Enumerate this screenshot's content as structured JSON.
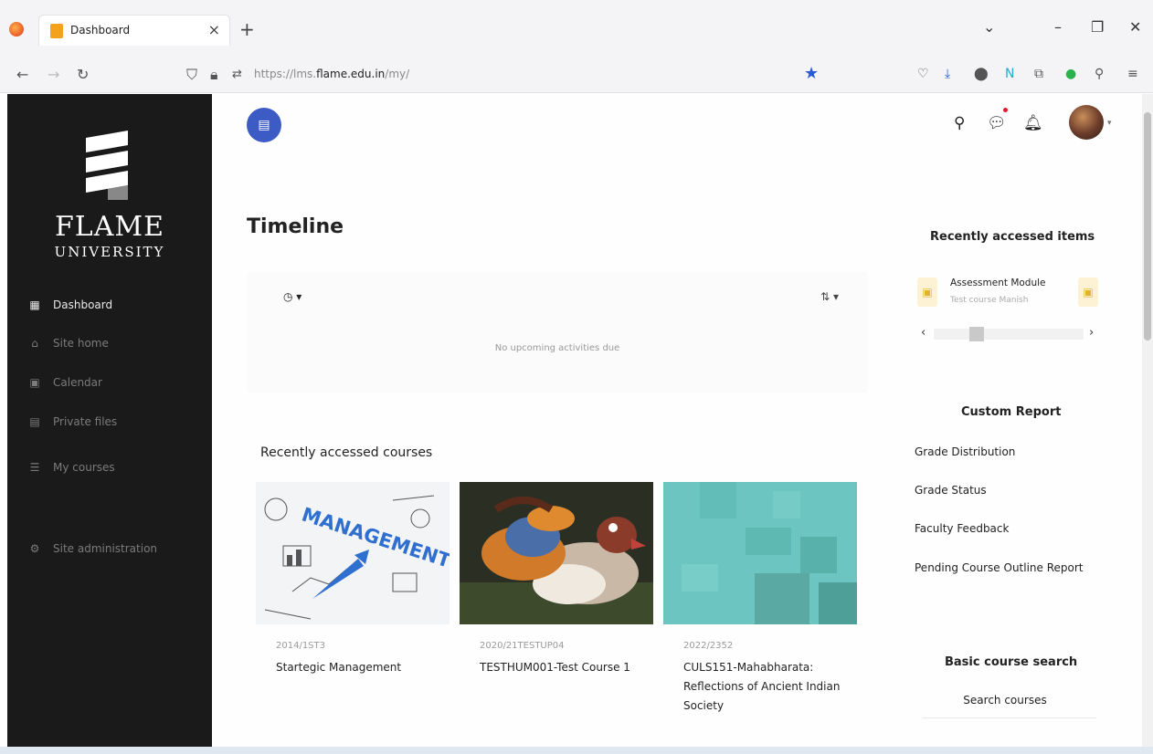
{
  "browser": {
    "tab_title": "Dashboard",
    "tab_close": "×",
    "new_tab": "+",
    "url_prefix": "https://lms.",
    "url_domain": "flame.edu.in",
    "url_suffix": "/my/"
  },
  "brand": {
    "line1": "FLAME",
    "line2": "UNIVERSITY"
  },
  "sidebar": {
    "items": [
      {
        "label": "Dashboard",
        "icon": "dashboard-icon"
      },
      {
        "label": "Site home",
        "icon": "home-icon"
      },
      {
        "label": "Calendar",
        "icon": "calendar-icon"
      },
      {
        "label": "Private files",
        "icon": "files-icon"
      },
      {
        "label": "My courses",
        "icon": "courses-icon"
      },
      {
        "label": "Site administration",
        "icon": "gear-icon"
      }
    ]
  },
  "timeline": {
    "title": "Timeline",
    "empty_text": "No upcoming activities due"
  },
  "courses": {
    "title": "Recently accessed courses",
    "items": [
      {
        "code": "2014/1ST3",
        "name": "Startegic Management"
      },
      {
        "code": "2020/21TESTUP04",
        "name": "TESTHUM001-Test Course 1"
      },
      {
        "code": "2022/2352",
        "name": "CULS151-Mahabharata: Reflections of Ancient Indian Society"
      }
    ]
  },
  "recent_items": {
    "title": "Recently accessed items",
    "item_name": "Assessment Module",
    "item_sub": "Test course Manish"
  },
  "custom_report": {
    "title": "Custom Report",
    "links": [
      "Grade Distribution",
      "Grade Status",
      "Faculty Feedback",
      "Pending Course Outline Report"
    ]
  },
  "course_search": {
    "title": "Basic course search",
    "link": "Search courses"
  },
  "colors": {
    "sidebar_bg": "#1a1a1a",
    "menu_button": "#3c5bc4",
    "bookmark_star": "#2a5bd7",
    "notification_dot": "#e21b2b",
    "course_tile_teal": "#6cc5c0"
  }
}
